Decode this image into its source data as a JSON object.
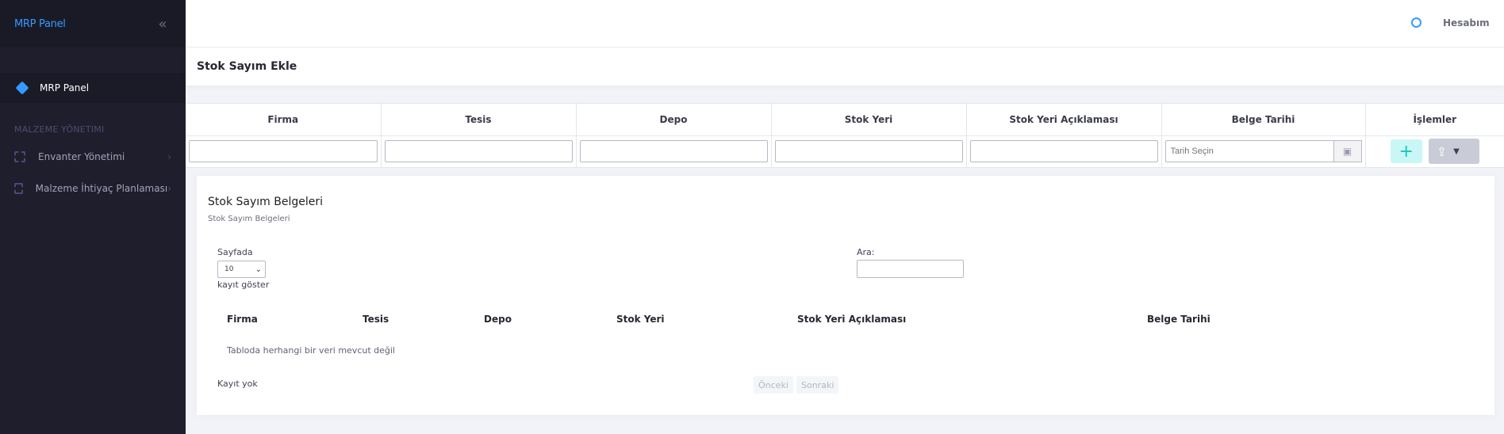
{
  "sidebar": {
    "brand": "MRP Panel",
    "collapse_icon": "double-chevron-left-icon",
    "active_item": "MRP Panel",
    "section_title": "MALZEME YÖNETIMI",
    "items": [
      {
        "label": "Envanter Yönetimi"
      },
      {
        "label": "Malzeme İhtiyaç Planlaması"
      }
    ]
  },
  "header": {
    "account_label": "Hesabım"
  },
  "subheader": {
    "title": "Stok Sayım Ekle"
  },
  "form": {
    "columns": [
      "Firma",
      "Tesis",
      "Depo",
      "Stok Yeri",
      "Stok Yeri Açıklaması",
      "Belge Tarihi",
      "İşlemler"
    ],
    "date_placeholder": "Tarih Seçin"
  },
  "card": {
    "title": "Stok Sayım Belgeleri",
    "subtitle": "Stok Sayım Belgeleri",
    "length_prefix": "Sayfada",
    "length_value": "10",
    "length_suffix": "kayıt göster",
    "search_label": "Ara:",
    "columns": [
      "Firma",
      "Tesis",
      "Depo",
      "Stok Yeri",
      "Stok Yeri Açıklaması",
      "Belge Tarihi"
    ],
    "empty_message": "Tabloda herhangi bir veri mevcut değil",
    "info": "Kayıt yok",
    "prev_label": "Önceki",
    "next_label": "Sonraki"
  },
  "colors": {
    "sidebar_bg": "#1e1e2d",
    "accent": "#3699ff",
    "success_light": "#c9f7f5",
    "success": "#1bc5bd"
  }
}
